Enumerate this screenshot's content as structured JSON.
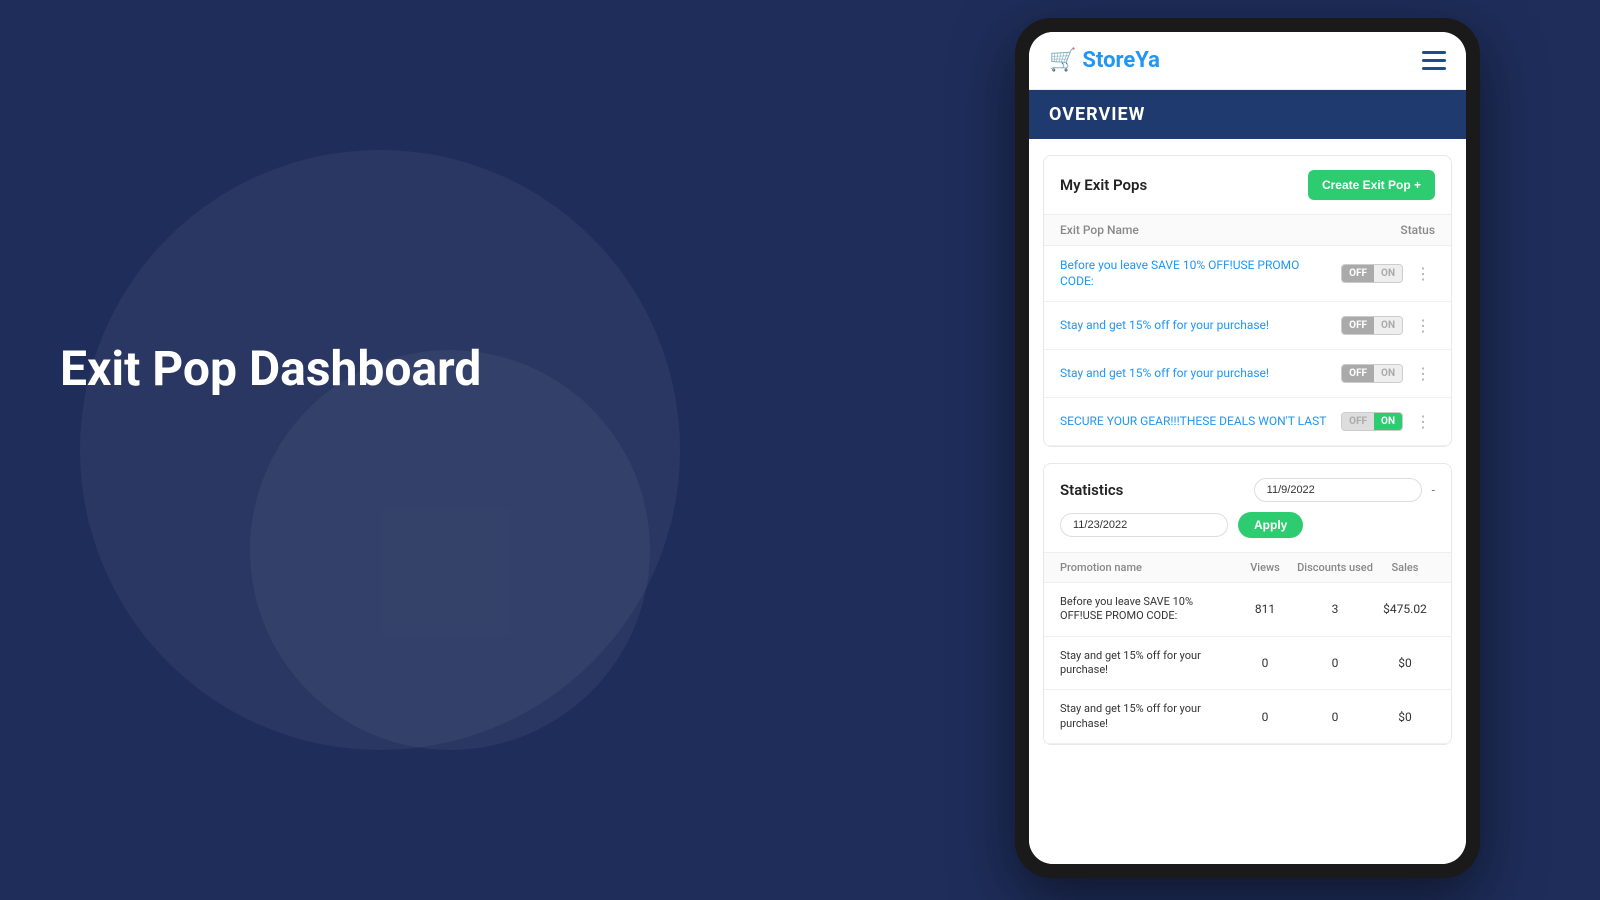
{
  "background": {
    "color": "#1e2d5a"
  },
  "hero": {
    "title": "Exit Pop Dashboard"
  },
  "app": {
    "logo_cart_icon": "🛒",
    "logo_store": "Store",
    "logo_ya": "Ya",
    "hamburger_label": "menu"
  },
  "overview": {
    "title": "OVERVIEW"
  },
  "exit_pops_section": {
    "title": "My Exit Pops",
    "create_button_label": "Create Exit Pop +",
    "table_header": {
      "name_col": "Exit Pop Name",
      "status_col": "Status"
    },
    "rows": [
      {
        "name": "Before you leave SAVE 10% OFF!USE PROMO CODE:",
        "toggle_off": "OFF",
        "toggle_on": "ON",
        "state": "off"
      },
      {
        "name": "Stay and get 15% off for your purchase!",
        "toggle_off": "OFF",
        "toggle_on": "ON",
        "state": "off"
      },
      {
        "name": "Stay and get 15% off for your purchase!",
        "toggle_off": "OFF",
        "toggle_on": "ON",
        "state": "off"
      },
      {
        "name": "SECURE YOUR GEAR!!!THESE DEALS WON'T LAST",
        "toggle_off": "OFF",
        "toggle_on": "ON",
        "state": "on"
      }
    ]
  },
  "statistics_section": {
    "title": "Statistics",
    "date_from": "11/9/2022",
    "date_to": "11/23/2022",
    "date_separator": "-",
    "apply_button_label": "Apply",
    "table_header": {
      "promo_col": "Promotion name",
      "views_col": "Views",
      "discounts_col": "Discounts used",
      "sales_col": "Sales"
    },
    "rows": [
      {
        "name": "Before you leave SAVE 10% OFF!USE PROMO CODE:",
        "views": "811",
        "discounts": "3",
        "sales": "$475.02"
      },
      {
        "name": "Stay and get 15% off for your purchase!",
        "views": "0",
        "discounts": "0",
        "sales": "$0"
      },
      {
        "name": "Stay and get 15% off for your purchase!",
        "views": "0",
        "discounts": "0",
        "sales": "$0"
      }
    ]
  }
}
